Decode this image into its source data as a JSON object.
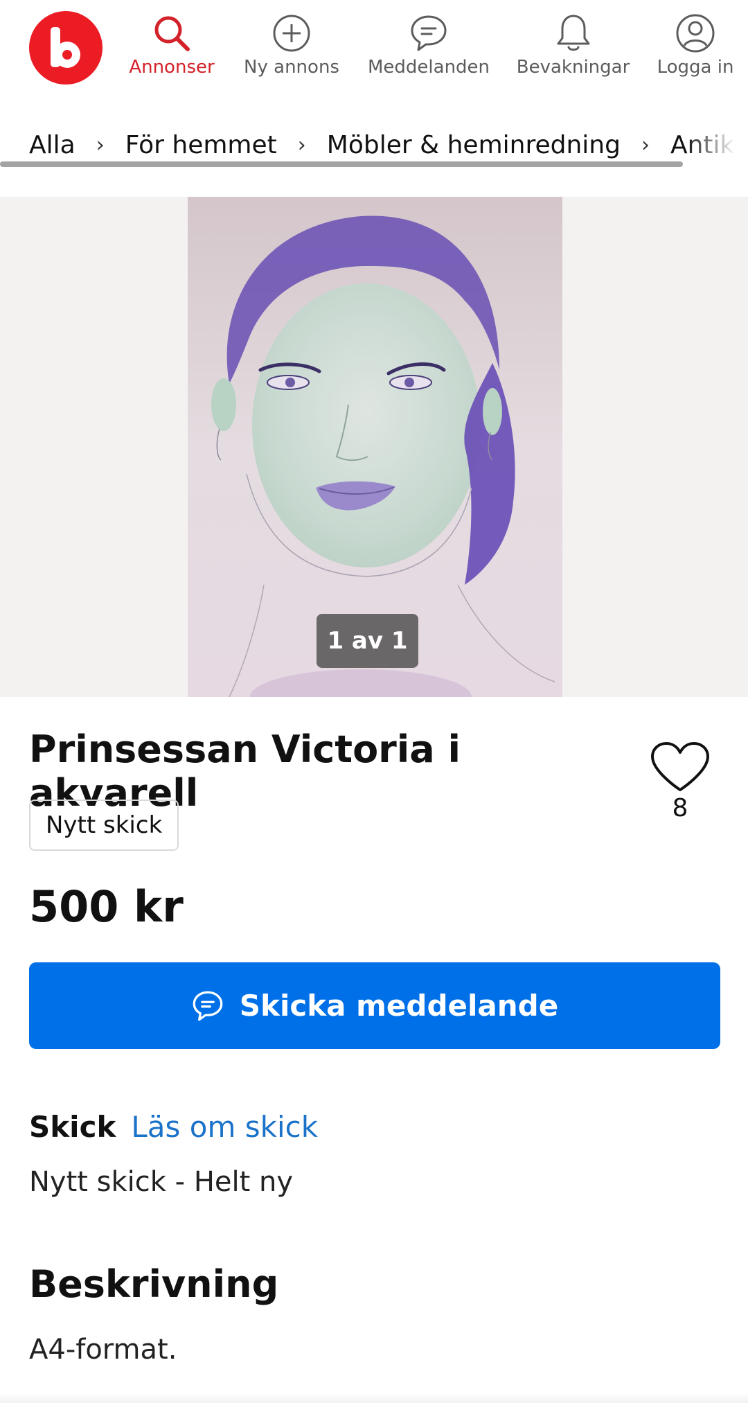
{
  "nav": {
    "items": [
      {
        "label": "Annonser",
        "icon": "search-icon",
        "active": true
      },
      {
        "label": "Ny annons",
        "icon": "plus-circle-icon",
        "active": false
      },
      {
        "label": "Meddelanden",
        "icon": "chat-bubble-icon",
        "active": false
      },
      {
        "label": "Bevakningar",
        "icon": "bell-icon",
        "active": false
      },
      {
        "label": "Logga in",
        "icon": "user-circle-icon",
        "active": false
      }
    ],
    "logo_icon": "blocket-logo-icon",
    "accent_color": "#d4222a"
  },
  "breadcrumb": {
    "items": [
      "Alla",
      "För hemmet",
      "Möbler & heminredning",
      "Antikt & "
    ],
    "separator": "›"
  },
  "gallery": {
    "image_alt": "watercolor-portrait-image",
    "counter": "1 av 1"
  },
  "listing": {
    "title": "Prinsessan Victoria i akvarell",
    "favorites_count": "8",
    "favorite_icon": "heart-outline-icon",
    "condition_chip": "Nytt skick",
    "price": "500 kr",
    "message_button": "Skicka meddelande",
    "message_button_icon": "chat-bubble-icon",
    "button_color": "#0070e8"
  },
  "condition": {
    "heading": "Skick",
    "link": "Läs om skick",
    "value": "Nytt skick - Helt ny"
  },
  "description": {
    "heading": "Beskrivning",
    "text": "A4-format."
  }
}
